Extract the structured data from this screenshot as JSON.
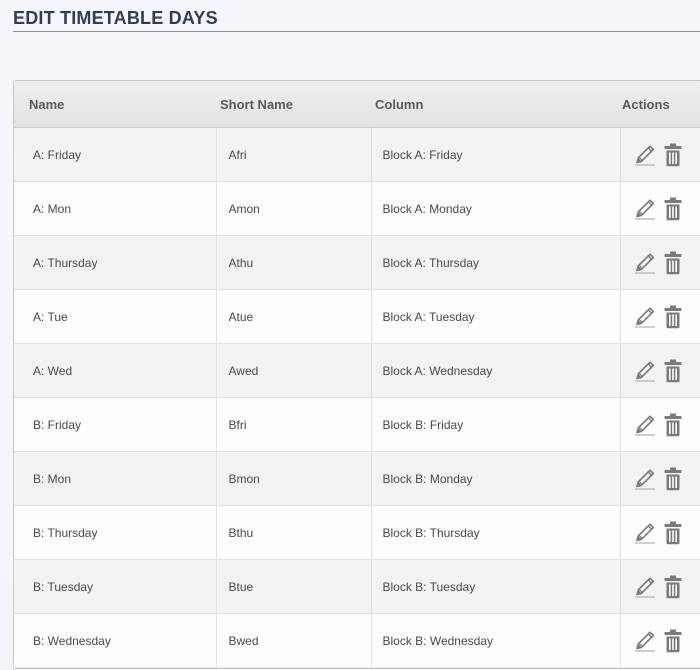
{
  "page": {
    "title": "EDIT TIMETABLE DAYS"
  },
  "table": {
    "headers": {
      "name": "Name",
      "short_name": "Short Name",
      "column": "Column",
      "actions": "Actions"
    },
    "rows": [
      {
        "name": "A: Friday",
        "short_name": "Afri",
        "column": "Block A: Friday"
      },
      {
        "name": "A: Mon",
        "short_name": "Amon",
        "column": "Block A: Monday"
      },
      {
        "name": "A: Thursday",
        "short_name": "Athu",
        "column": "Block A: Thursday"
      },
      {
        "name": "A: Tue",
        "short_name": "Atue",
        "column": "Block A: Tuesday"
      },
      {
        "name": "A: Wed",
        "short_name": "Awed",
        "column": "Block A: Wednesday"
      },
      {
        "name": "B: Friday",
        "short_name": "Bfri",
        "column": "Block B: Friday"
      },
      {
        "name": "B: Mon",
        "short_name": "Bmon",
        "column": "Block B: Monday"
      },
      {
        "name": "B: Thursday",
        "short_name": "Bthu",
        "column": "Block B: Thursday"
      },
      {
        "name": "B: Tuesday",
        "short_name": "Btue",
        "column": "Block B: Tuesday"
      },
      {
        "name": "B: Wednesday",
        "short_name": "Bwed",
        "column": "Block B: Wednesday"
      }
    ],
    "row_actions": [
      {
        "icon": "pencil-icon"
      },
      {
        "icon": "trash-icon"
      }
    ]
  },
  "colors": {
    "title": "#2f3e57",
    "icon": "#7a7a7a"
  }
}
